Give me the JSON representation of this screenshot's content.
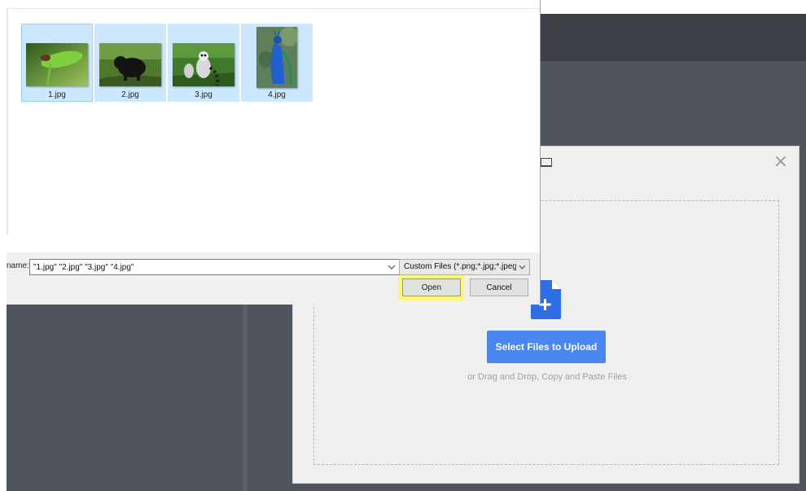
{
  "file_dialog": {
    "files": [
      {
        "name": "1.jpg",
        "thumb": "leaf-bird-photo"
      },
      {
        "name": "2.jpg",
        "thumb": "black-bear-photo"
      },
      {
        "name": "3.jpg",
        "thumb": "lemur-photo"
      },
      {
        "name": "4.jpg",
        "thumb": "peacock-photo"
      }
    ],
    "filename_label": "name:",
    "filename_value": "\"1.jpg\" \"2.jpg\" \"3.jpg\" \"4.jpg\"",
    "filetype_value": "Custom Files (*.png;*.jpg;*.jpeg",
    "open_label": "Open",
    "cancel_label": "Cancel"
  },
  "upload_modal": {
    "close_label": "×",
    "select_button_label": "Select Files to Upload",
    "drag_drop_text": "or Drag and Drop, Copy and Paste Files",
    "accent_color": "#4a86f1"
  },
  "colors": {
    "app_topbar": "#3d4047",
    "app_body": "#50545c",
    "selection": "#cce8ff",
    "open_highlight": "#fbf67a"
  }
}
